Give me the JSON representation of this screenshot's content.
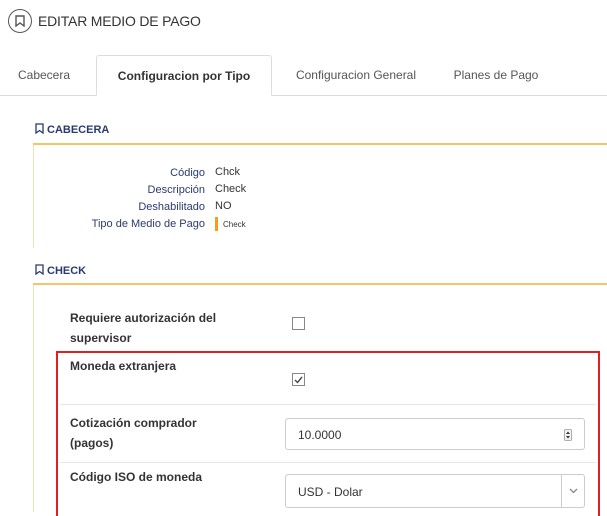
{
  "page": {
    "title": "EDITAR MEDIO DE PAGO"
  },
  "tabs": [
    {
      "label": "Cabecera",
      "active": false
    },
    {
      "label": "Configuracion por Tipo",
      "active": true
    },
    {
      "label": "Configuracion General",
      "active": false
    },
    {
      "label": "Planes de Pago",
      "active": false
    }
  ],
  "cabecera": {
    "title": "CABECERA",
    "fields": [
      {
        "label": "Código",
        "value": "Chck"
      },
      {
        "label": "Descripción",
        "value": "Check"
      },
      {
        "label": "Deshabilitado",
        "value": "NO"
      },
      {
        "label": "Tipo de Medio de Pago",
        "value": "Check"
      }
    ]
  },
  "check": {
    "title": "CHECK",
    "requiere_autorizacion": {
      "label_line1": "Requiere autorización del",
      "label_line2": "supervisor",
      "checked": false
    },
    "moneda_extranjera": {
      "label": "Moneda extranjera",
      "checked": true
    },
    "cotizacion": {
      "label_line1": "Cotización comprador",
      "label_line2": "(pagos)",
      "value": "10.0000"
    },
    "codigo_iso": {
      "label": "Código ISO de moneda",
      "value": "USD - Dolar"
    }
  },
  "colors": {
    "accent": "#f5c56a",
    "highlight": "#e02020",
    "section_title": "#2b3a6e"
  },
  "icons": [
    "bookmark-icon",
    "checkmark-icon",
    "spinner-icon",
    "chevron-down-icon"
  ]
}
